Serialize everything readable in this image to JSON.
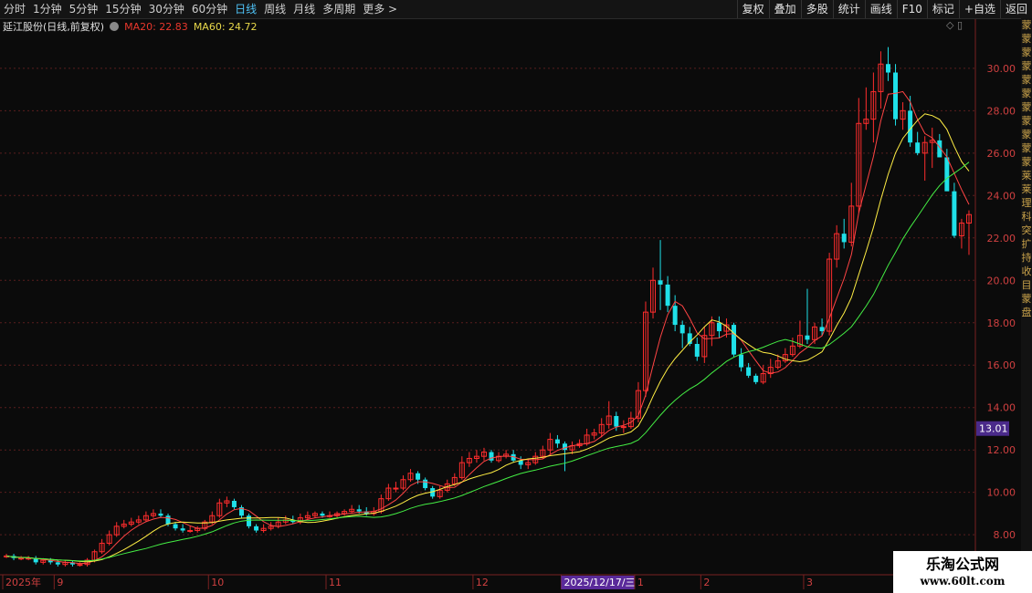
{
  "toolbar": {
    "periods": [
      "分时",
      "1分钟",
      "5分钟",
      "15分钟",
      "30分钟",
      "60分钟",
      "日线",
      "周线",
      "月线",
      "多周期",
      "更多 >"
    ],
    "active_period": "日线",
    "tools": [
      "复权",
      "叠加",
      "多股",
      "统计",
      "画线",
      "F10",
      "标记",
      "+自选",
      "返回"
    ]
  },
  "info": {
    "stock_title": "延江股份(日线,前复权)",
    "ma20_label": "MA20: 22.83",
    "ma60_label": "MA60: 24.72",
    "window_controls": "◇ ▯"
  },
  "side_text": [
    "蒙",
    "蒙",
    "蒙",
    "蒙",
    "蒙",
    "蒙",
    "蒙",
    "蒙",
    "蒙",
    "蒙",
    "蒙",
    "莱",
    "莱",
    "理",
    "科",
    "突",
    "扩",
    "持",
    "收",
    "目",
    "蒙",
    "盘"
  ],
  "watermark": {
    "line1": "乐淘公式网",
    "line2": "www.60lt.com"
  },
  "colors": {
    "up": "#ff2d2d",
    "down": "#1fe0e8",
    "ma20": "#ffee44",
    "ma60": "#44ee44",
    "ma5": "#ff4444",
    "grid": "#5a1e1e",
    "price_tag": "#4a2a8a"
  },
  "chart_data": {
    "type": "candlestick",
    "y_ticks": [
      8,
      10,
      12,
      14,
      16,
      18,
      20,
      22,
      24,
      26,
      28,
      30
    ],
    "y_tick_labels": [
      "8.00",
      "10.00",
      "12.00",
      "14.00",
      "16.00",
      "18.00",
      "20.00",
      "22.00",
      "24.00",
      "26.00",
      "28.00",
      "30.00"
    ],
    "ylim": [
      6.2,
      31.5
    ],
    "x_labels": [
      {
        "label": "2025年",
        "index": 0
      },
      {
        "label": "9",
        "index": 7
      },
      {
        "label": "10",
        "index": 28
      },
      {
        "label": "11",
        "index": 44
      },
      {
        "label": "12",
        "index": 64
      },
      {
        "label": "2025/12/17/三",
        "index": 76,
        "highlight": true
      },
      {
        "label": "1",
        "index": 86
      },
      {
        "label": "2",
        "index": 95
      },
      {
        "label": "3",
        "index": 109
      }
    ],
    "current_price": "13.01",
    "current_price_value": 13.01,
    "open": [
      7.0,
      7.0,
      6.9,
      6.9,
      6.9,
      6.7,
      6.8,
      6.7,
      6.6,
      6.7,
      6.6,
      6.6,
      6.8,
      7.2,
      7.6,
      8.0,
      8.4,
      8.5,
      8.6,
      8.7,
      8.9,
      9.0,
      8.9,
      8.5,
      8.3,
      8.2,
      8.2,
      8.3,
      8.6,
      8.9,
      9.5,
      9.6,
      9.3,
      8.9,
      8.4,
      8.2,
      8.3,
      8.4,
      8.6,
      8.7,
      8.6,
      8.8,
      8.9,
      9.0,
      8.9,
      8.9,
      9.0,
      9.1,
      9.2,
      9.1,
      9.0,
      9.1,
      9.7,
      10.2,
      10.2,
      10.6,
      10.9,
      10.6,
      10.2,
      9.8,
      10.1,
      10.4,
      10.7,
      11.4,
      11.6,
      11.7,
      11.9,
      11.5,
      11.7,
      11.8,
      11.5,
      11.3,
      11.4,
      11.7,
      12.0,
      12.5,
      12.3,
      12.0,
      12.2,
      12.3,
      12.7,
      12.8,
      13.2,
      13.6,
      13.1,
      13.1,
      13.5,
      14.8,
      18.5,
      20.0,
      19.8,
      18.8,
      17.9,
      17.5,
      17.0,
      16.4,
      17.4,
      18.0,
      17.6,
      17.9,
      16.5,
      15.9,
      15.5,
      15.2,
      15.6,
      15.9,
      16.2,
      16.5,
      16.9,
      17.4,
      17.2,
      17.8,
      17.6,
      21.0,
      22.2,
      21.8,
      23.5,
      27.4,
      27.6,
      28.9,
      30.2,
      29.8,
      27.6,
      28.0,
      26.5,
      26.0,
      26.5,
      26.6,
      25.8,
      24.2,
      22.1,
      22.7
    ],
    "close": [
      7.0,
      6.9,
      6.9,
      6.9,
      6.7,
      6.8,
      6.7,
      6.6,
      6.7,
      6.6,
      6.6,
      6.8,
      7.2,
      7.6,
      8.0,
      8.4,
      8.5,
      8.6,
      8.7,
      8.9,
      9.0,
      8.9,
      8.5,
      8.3,
      8.2,
      8.2,
      8.3,
      8.6,
      8.9,
      9.5,
      9.6,
      9.3,
      8.9,
      8.4,
      8.2,
      8.3,
      8.4,
      8.6,
      8.7,
      8.6,
      8.8,
      8.9,
      9.0,
      8.9,
      8.9,
      9.0,
      9.1,
      9.2,
      9.1,
      9.0,
      9.1,
      9.7,
      10.2,
      10.2,
      10.6,
      10.9,
      10.6,
      10.2,
      9.8,
      10.1,
      10.4,
      10.7,
      11.4,
      11.6,
      11.7,
      11.9,
      11.5,
      11.7,
      11.8,
      11.5,
      11.3,
      11.4,
      11.7,
      12.0,
      12.5,
      12.3,
      12.0,
      12.2,
      12.3,
      12.7,
      12.8,
      13.2,
      13.6,
      13.1,
      13.1,
      13.5,
      14.8,
      18.5,
      20.0,
      19.8,
      18.8,
      17.9,
      17.5,
      17.0,
      16.4,
      17.4,
      18.0,
      17.6,
      17.9,
      16.5,
      15.9,
      15.5,
      15.2,
      15.6,
      15.9,
      16.2,
      16.5,
      16.9,
      17.4,
      17.2,
      17.8,
      17.6,
      21.0,
      22.2,
      21.8,
      23.5,
      27.4,
      27.6,
      28.9,
      30.2,
      29.8,
      27.6,
      28.0,
      26.5,
      26.0,
      26.5,
      26.6,
      25.8,
      24.2,
      22.1,
      22.7,
      23.1
    ],
    "high": [
      7.1,
      7.1,
      7.0,
      7.0,
      7.0,
      6.9,
      6.9,
      6.8,
      6.8,
      6.8,
      6.7,
      6.9,
      7.3,
      7.8,
      8.2,
      8.6,
      8.7,
      8.8,
      8.9,
      9.1,
      9.2,
      9.2,
      9.0,
      8.6,
      8.5,
      8.4,
      8.4,
      8.7,
      9.1,
      9.7,
      9.8,
      9.7,
      9.4,
      9.0,
      8.5,
      8.5,
      8.6,
      8.8,
      8.9,
      8.9,
      9.0,
      9.1,
      9.1,
      9.1,
      9.1,
      9.1,
      9.2,
      9.4,
      9.4,
      9.3,
      9.3,
      9.9,
      10.4,
      10.5,
      10.8,
      11.1,
      11.0,
      10.7,
      10.3,
      10.3,
      10.6,
      10.9,
      11.7,
      11.9,
      12.0,
      12.1,
      12.0,
      11.9,
      12.0,
      12.0,
      11.7,
      11.6,
      11.9,
      12.2,
      12.8,
      12.7,
      12.4,
      12.4,
      12.5,
      13.0,
      13.0,
      13.5,
      14.3,
      13.8,
      13.4,
      13.8,
      15.2,
      19.0,
      20.6,
      21.9,
      20.2,
      19.3,
      18.1,
      17.8,
      17.3,
      17.8,
      18.3,
      18.3,
      18.2,
      18.0,
      16.8,
      16.1,
      15.6,
      16.0,
      16.3,
      16.5,
      16.8,
      17.3,
      18.1,
      19.6,
      18.0,
      18.2,
      21.3,
      22.6,
      22.9,
      24.6,
      28.6,
      29.1,
      29.8,
      30.8,
      31.0,
      30.2,
      28.4,
      28.7,
      27.0,
      26.8,
      27.2,
      26.9,
      26.2,
      24.6,
      22.9,
      23.3
    ],
    "low": [
      6.9,
      6.8,
      6.8,
      6.8,
      6.6,
      6.6,
      6.6,
      6.5,
      6.5,
      6.5,
      6.5,
      6.5,
      6.7,
      7.1,
      7.5,
      7.9,
      8.3,
      8.4,
      8.5,
      8.6,
      8.8,
      8.8,
      8.4,
      8.2,
      8.1,
      8.1,
      8.1,
      8.2,
      8.5,
      8.8,
      9.3,
      9.2,
      8.8,
      8.3,
      8.1,
      8.1,
      8.2,
      8.3,
      8.5,
      8.5,
      8.5,
      8.7,
      8.8,
      8.8,
      8.8,
      8.8,
      8.9,
      9.0,
      9.0,
      8.9,
      8.9,
      9.0,
      9.6,
      10.0,
      10.1,
      10.5,
      10.4,
      10.1,
      9.7,
      9.7,
      10.0,
      10.3,
      10.6,
      11.2,
      11.4,
      11.5,
      11.4,
      11.4,
      11.6,
      11.4,
      11.1,
      11.1,
      11.3,
      11.6,
      11.8,
      12.1,
      11.0,
      11.8,
      12.1,
      12.2,
      12.5,
      12.6,
      13.0,
      12.9,
      12.8,
      13.0,
      13.3,
      14.5,
      18.2,
      18.6,
      18.5,
      17.6,
      16.8,
      16.9,
      16.2,
      16.1,
      16.9,
      17.3,
      17.3,
      16.4,
      15.7,
      15.4,
      15.1,
      15.1,
      15.4,
      15.8,
      16.1,
      16.4,
      16.8,
      17.0,
      17.0,
      17.4,
      17.4,
      20.6,
      21.5,
      21.6,
      23.2,
      27.1,
      26.5,
      28.1,
      29.4,
      27.3,
      27.1,
      26.3,
      25.9,
      24.7,
      25.3,
      26.0,
      24.9,
      22.0,
      21.5,
      21.2
    ]
  }
}
